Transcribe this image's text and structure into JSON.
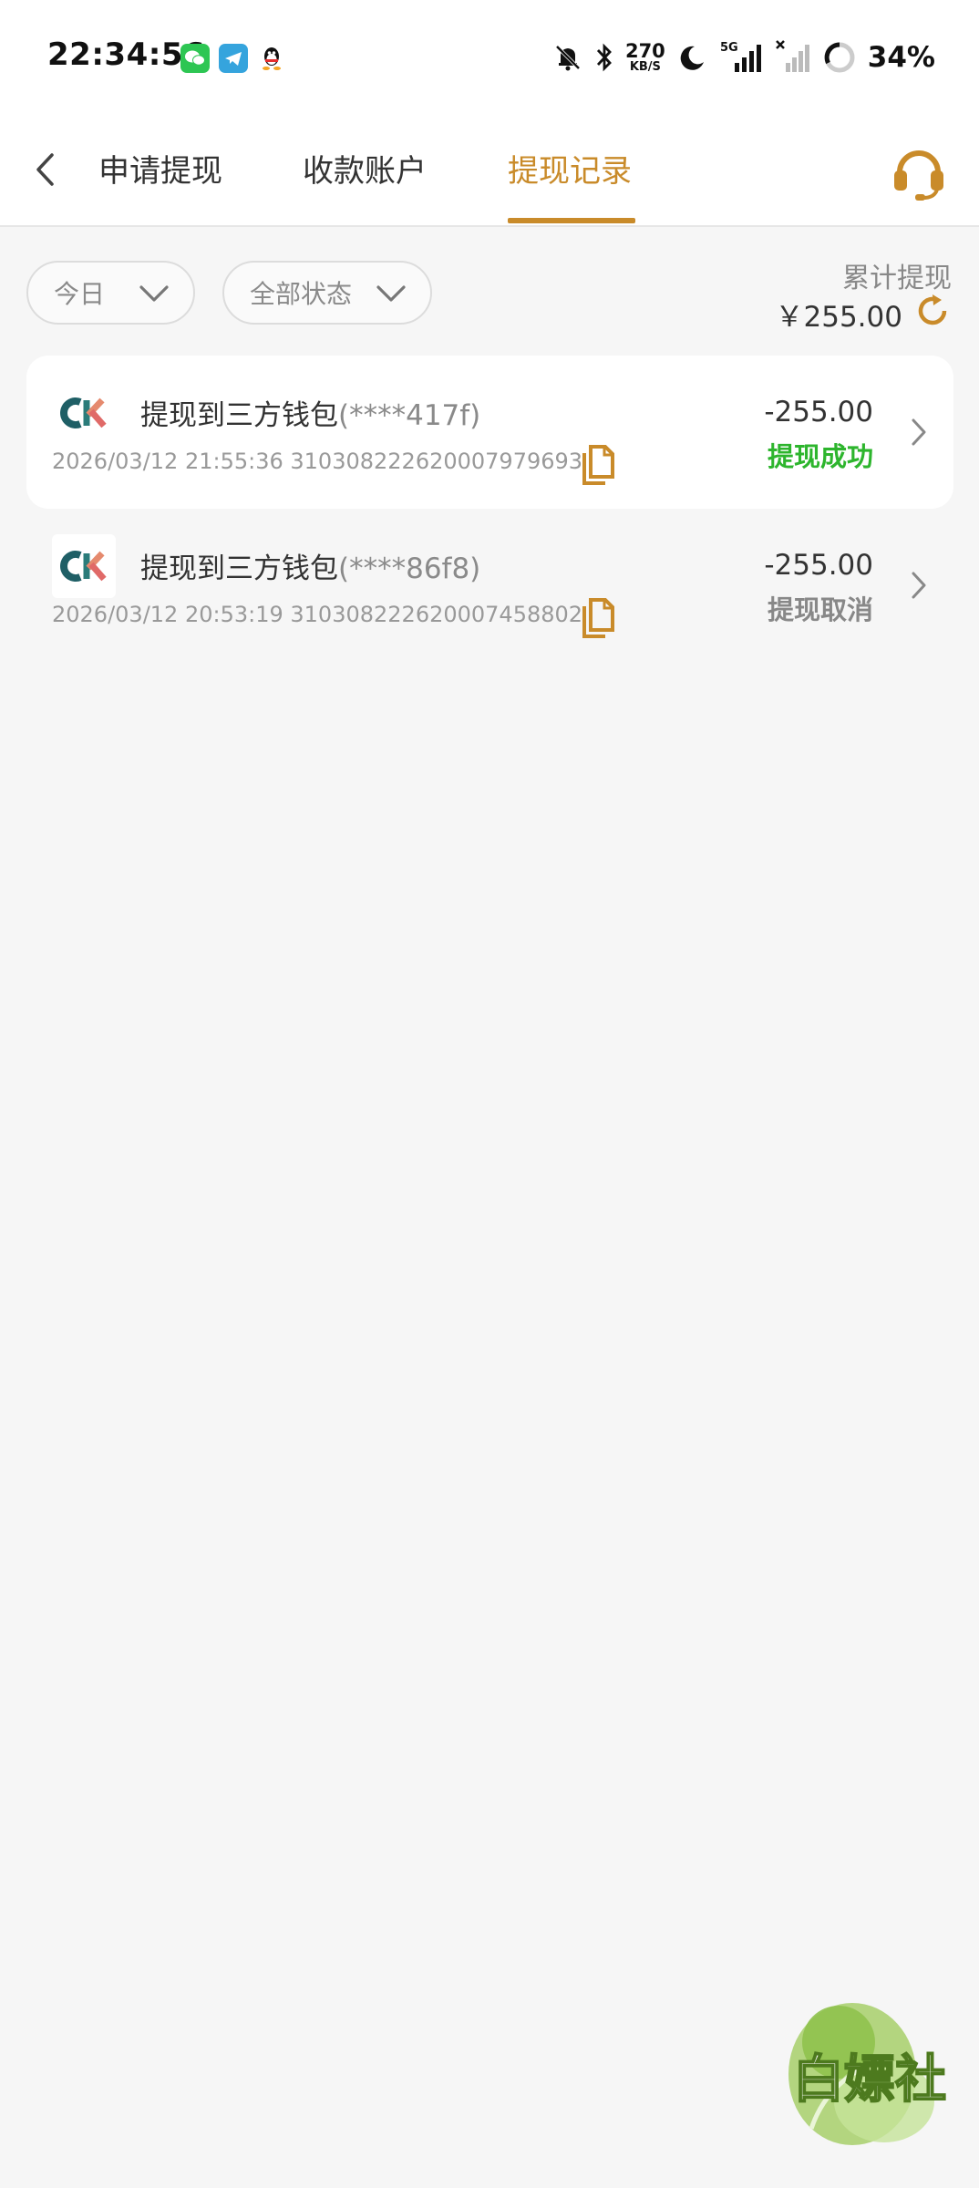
{
  "status_bar": {
    "time": "22:34:56",
    "net_speed_value": "270",
    "net_speed_unit": "KB/S",
    "network_type": "5G",
    "battery": "34%",
    "apps": [
      "wechat-icon",
      "telegram-icon",
      "qq-icon"
    ],
    "icons": [
      "mute-bell-icon",
      "bluetooth-icon",
      "moon-icon",
      "signal-icon",
      "signal-no-service-icon",
      "battery-ring-icon"
    ]
  },
  "header": {
    "tabs": [
      {
        "label": "申请提现",
        "active": false
      },
      {
        "label": "收款账户",
        "active": false
      },
      {
        "label": "提现记录",
        "active": true
      }
    ],
    "accent_color": "#c98b2a"
  },
  "filters": {
    "date": "今日",
    "status": "全部状态"
  },
  "summary": {
    "label": "累计提现",
    "amount": "￥255.00"
  },
  "records": [
    {
      "title": "提现到三方钱包",
      "account_mask": "(****417f)",
      "datetime": "2026/03/12 21:55:36",
      "order_no": "310308222620007979693",
      "amount": "-255.00",
      "status": "提现成功",
      "status_color": "#2db52d"
    },
    {
      "title": "提现到三方钱包",
      "account_mask": "(****86f8)",
      "datetime": "2026/03/12 20:53:19",
      "order_no": "310308222620007458802",
      "amount": "-255.00",
      "status": "提现取消",
      "status_color": "#888888"
    }
  ],
  "watermark": {
    "text": "白嫖社"
  }
}
